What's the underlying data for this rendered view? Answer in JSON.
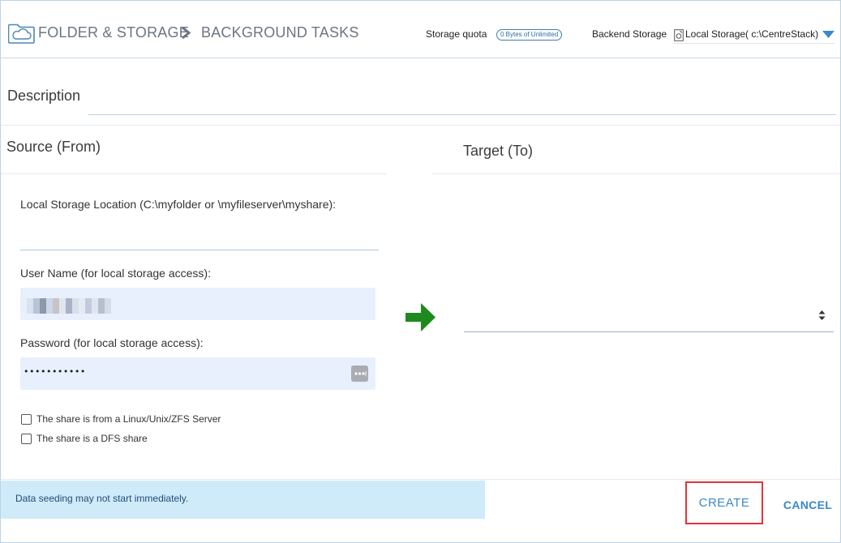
{
  "header": {
    "breadcrumb": [
      "FOLDER & STORAGE",
      "BACKGROUND TASKS"
    ],
    "storage_quota_label": "Storage quota",
    "storage_quota_value": "0 Bytes of Unlimited",
    "backend_storage_label": "Backend Storage",
    "backend_storage_value": "Local Storage( c:\\CentreStack)"
  },
  "description": {
    "label": "Description",
    "value": ""
  },
  "source": {
    "title": "Source (From)",
    "location_label": "Local Storage Location (C:\\myfolder or \\myfileserver\\myshare):",
    "location_value": "",
    "username_label": "User Name (for local storage access):",
    "password_label": "Password (for local storage access):",
    "password_value": "•••••••••••",
    "checkbox_linux_label": "The share is from a Linux/Unix/ZFS Server",
    "checkbox_linux_checked": false,
    "checkbox_dfs_label": "The share is a DFS share",
    "checkbox_dfs_checked": false
  },
  "target": {
    "title": "Target (To)",
    "selected_value": ""
  },
  "footer": {
    "notice": "Data seeding may not start immediately.",
    "create_label": "CREATE",
    "cancel_label": "CANCEL"
  },
  "icons": {
    "header_logo": "cloud-folder-icon",
    "breadcrumb_separator": "chevron-right-icon",
    "storage": "storage-drive-icon",
    "dropdown": "caret-down-icon",
    "transfer": "arrow-right-icon",
    "password_manager": "password-dots-icon",
    "select_arrows": "sort-arrows-icon"
  },
  "colors": {
    "accent": "#3a89c9",
    "arrow": "#1e8a1e",
    "notice_bg": "#cfeaf8",
    "autofill_bg": "#e8f0fe",
    "highlight": "#e0353a"
  }
}
